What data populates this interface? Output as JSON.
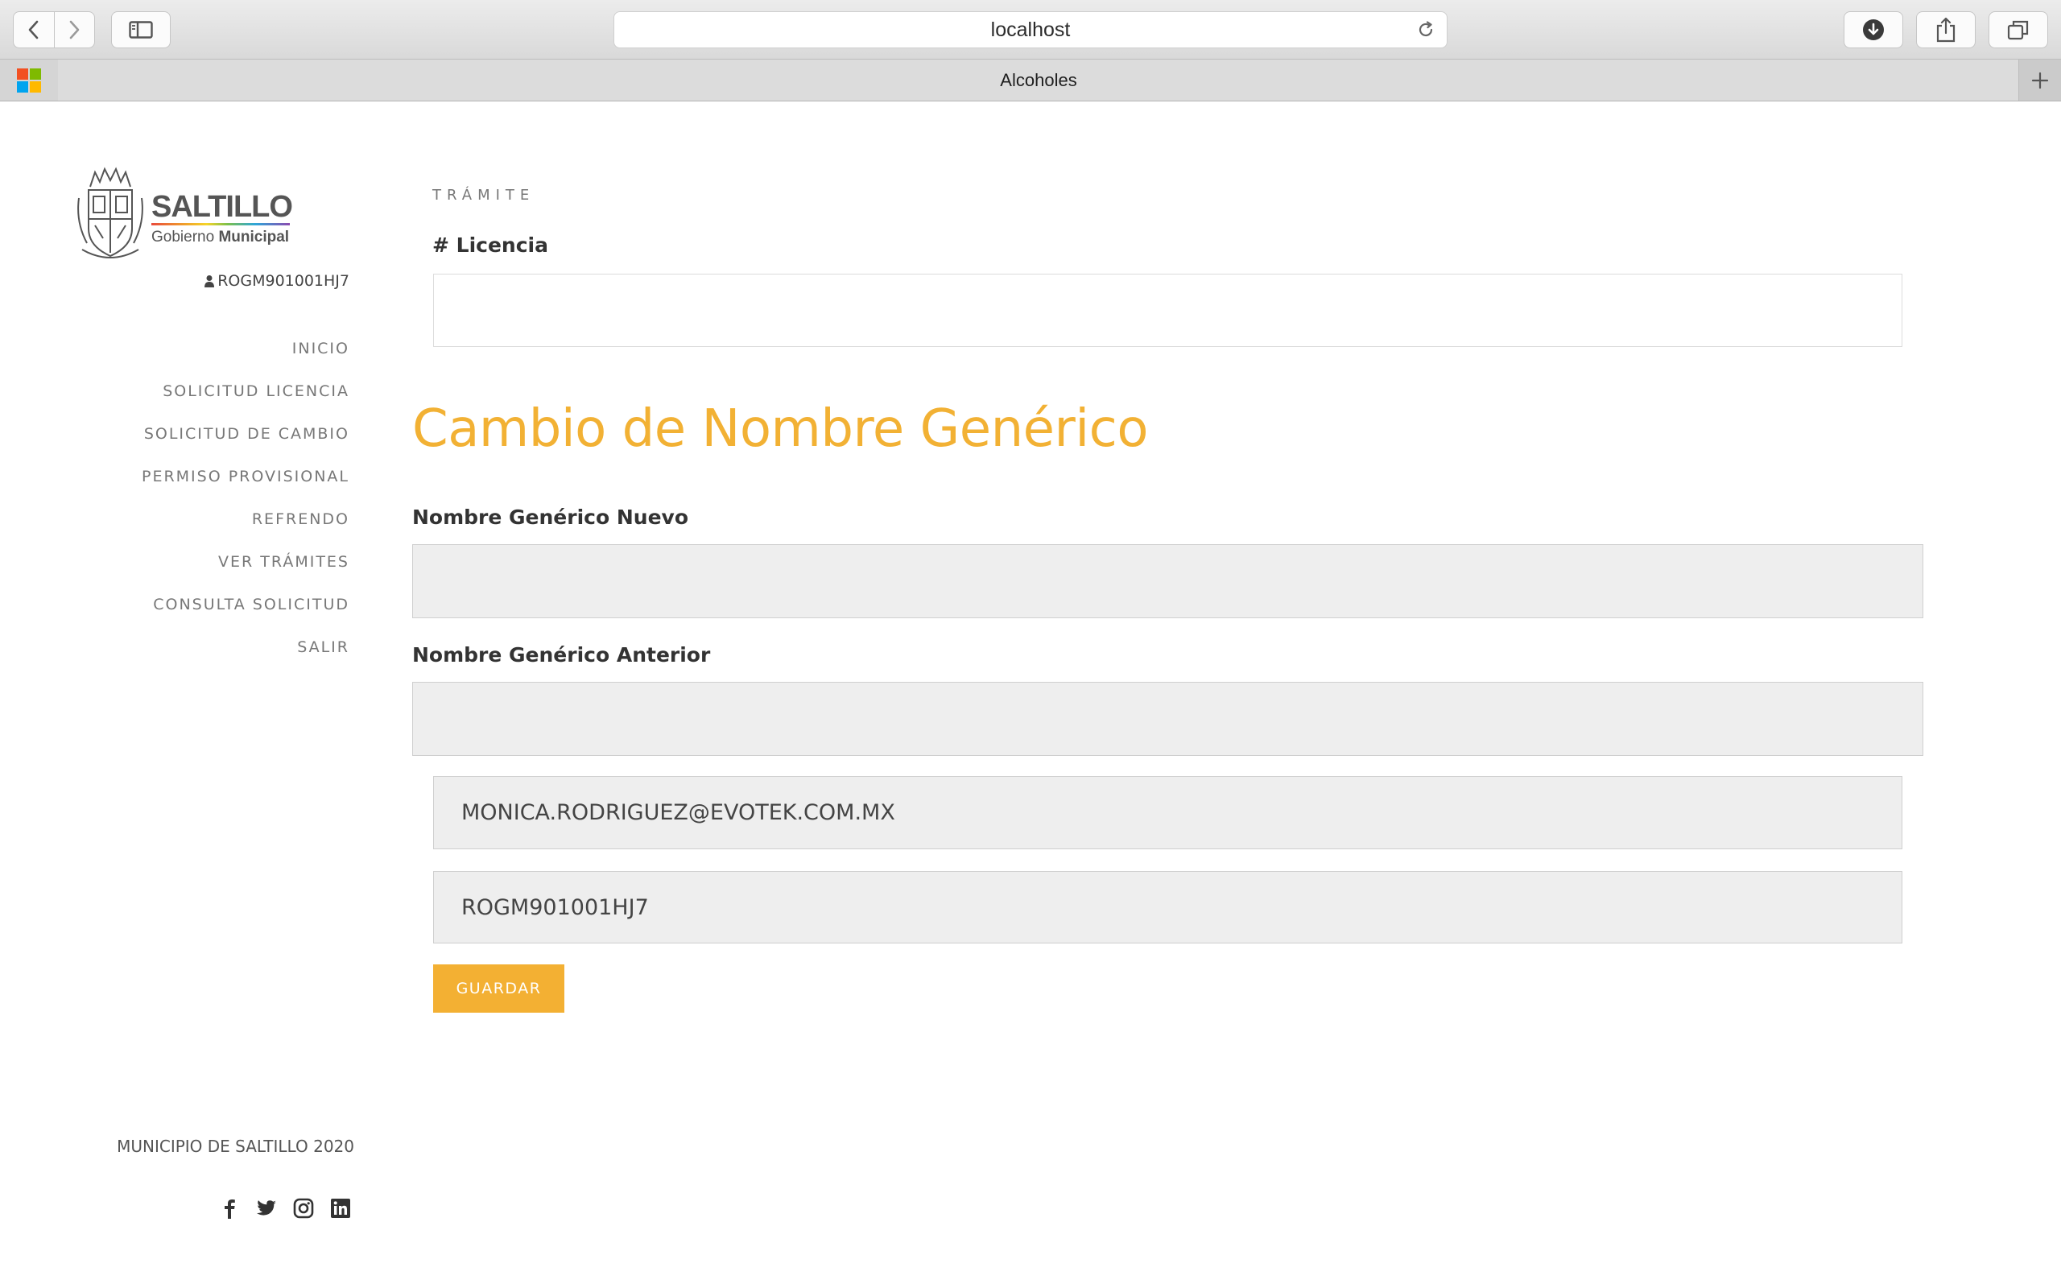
{
  "browser": {
    "url": "localhost",
    "tab_title": "Alcoholes"
  },
  "brand": {
    "logo_main": "SALTILLO",
    "logo_sub_a": "Gobierno ",
    "logo_sub_b": "Municipal"
  },
  "user": {
    "id": "ROGM901001HJ7"
  },
  "nav": {
    "items": [
      {
        "label": "INICIO"
      },
      {
        "label": "SOLICITUD LICENCIA"
      },
      {
        "label": "SOLICITUD DE CAMBIO"
      },
      {
        "label": "PERMISO PROVISIONAL"
      },
      {
        "label": "REFRENDO"
      },
      {
        "label": "VER TRÁMITES"
      },
      {
        "label": "CONSULTA SOLICITUD"
      },
      {
        "label": "SALIR"
      }
    ]
  },
  "form": {
    "kicker": "TRÁMITE",
    "licencia_label": "# Licencia",
    "licencia_value": "",
    "heading": "Cambio de Nombre Genérico",
    "nuevo_label": "Nombre Genérico Nuevo",
    "nuevo_value": "",
    "anterior_label": "Nombre Genérico Anterior",
    "anterior_value": "",
    "email_value": "MONICA.RODRIGUEZ@EVOTEK.COM.MX",
    "rfc_value": "ROGM901001HJ7",
    "save_label": "GUARDAR"
  },
  "footer": {
    "text": "MUNICIPIO DE SALTILLO 2020"
  },
  "social": [
    "facebook-icon",
    "twitter-icon",
    "instagram-icon",
    "linkedin-icon"
  ],
  "colors": {
    "accent": "#f2b134",
    "nav_text": "#777777"
  }
}
